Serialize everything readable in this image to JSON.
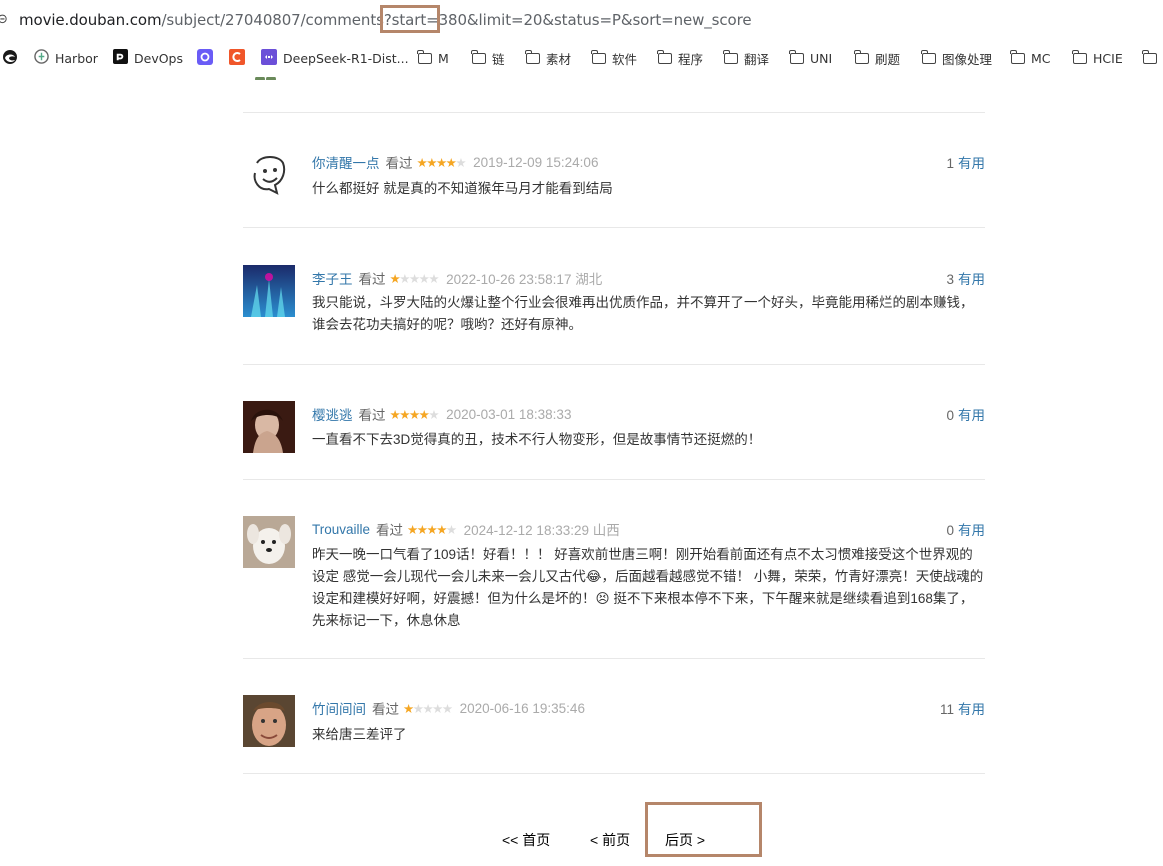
{
  "browser": {
    "url_host": "movie.douban.com",
    "url_path": "/subject/27040807/comments?start=380&limit=20&status=P&sort=new_score",
    "bookmarks": [
      {
        "label": "Harbor",
        "icon": "harbor-icon"
      },
      {
        "label": "DevOps",
        "icon": "devops-icon"
      },
      {
        "label": "",
        "icon": "purple-app-icon"
      },
      {
        "label": "",
        "icon": "c-app-icon"
      },
      {
        "label": "DeepSeek-R1-Dist...",
        "icon": "deepseek-icon"
      },
      {
        "label": "M",
        "icon": "folder-icon"
      },
      {
        "label": "链",
        "icon": "folder-icon"
      },
      {
        "label": "素材",
        "icon": "folder-icon"
      },
      {
        "label": "软件",
        "icon": "folder-icon"
      },
      {
        "label": "程序",
        "icon": "folder-icon"
      },
      {
        "label": "翻译",
        "icon": "folder-icon"
      },
      {
        "label": "UNI",
        "icon": "folder-icon"
      },
      {
        "label": "刷题",
        "icon": "folder-icon"
      },
      {
        "label": "图像处理",
        "icon": "folder-icon"
      },
      {
        "label": "MC",
        "icon": "folder-icon"
      },
      {
        "label": "HCIE",
        "icon": "folder-icon"
      },
      {
        "label": "",
        "icon": "folder-icon"
      }
    ]
  },
  "comments": [
    {
      "user": "你清醒一点",
      "status": "看过",
      "rating": 4,
      "time": "2019-12-09 15:24:06",
      "location": "",
      "useful_count": "1",
      "useful_label": "有用",
      "text": "什么都挺好 就是真的不知道猴年马月才能看到结局"
    },
    {
      "user": "李子王",
      "status": "看过",
      "rating": 1,
      "time": "2022-10-26 23:58:17",
      "location": "湖北",
      "useful_count": "3",
      "useful_label": "有用",
      "text": "我只能说，斗罗大陆的火爆让整个行业会很难再出优质作品，并不算开了一个好头，毕竟能用稀烂的剧本赚钱，谁会去花功夫搞好的呢？哦哟？还好有原神。"
    },
    {
      "user": "樱逃逃",
      "status": "看过",
      "rating": 4,
      "time": "2020-03-01 18:38:33",
      "location": "",
      "useful_count": "0",
      "useful_label": "有用",
      "text": "一直看不下去3D觉得真的丑，技术不行人物变形，但是故事情节还挺燃的！"
    },
    {
      "user": "Trouvaille",
      "status": "看过",
      "rating": 4,
      "time": "2024-12-12 18:33:29",
      "location": "山西",
      "useful_count": "0",
      "useful_label": "有用",
      "text": "昨天一晚一口气看了109话！好看！！！ 好喜欢前世唐三啊！刚开始看前面还有点不太习惯难接受这个世界观的设定 感觉一会儿现代一会儿未来一会儿又古代😂，后面越看越感觉不错！ 小舞，荣荣，竹青好漂亮！天使战魂的设定和建模好好啊，好震撼！但为什么是坏的！😣 挺不下来根本停不下来，下午醒来就是继续看追到168集了，先来标记一下，休息休息"
    },
    {
      "user": "竹间间间",
      "status": "看过",
      "rating": 1,
      "time": "2020-06-16 19:35:46",
      "location": "",
      "useful_count": "11",
      "useful_label": "有用",
      "text": "来给唐三差评了"
    }
  ],
  "pager": {
    "first": "<< 首页",
    "prev": "< 前页",
    "next": "后页 >"
  }
}
